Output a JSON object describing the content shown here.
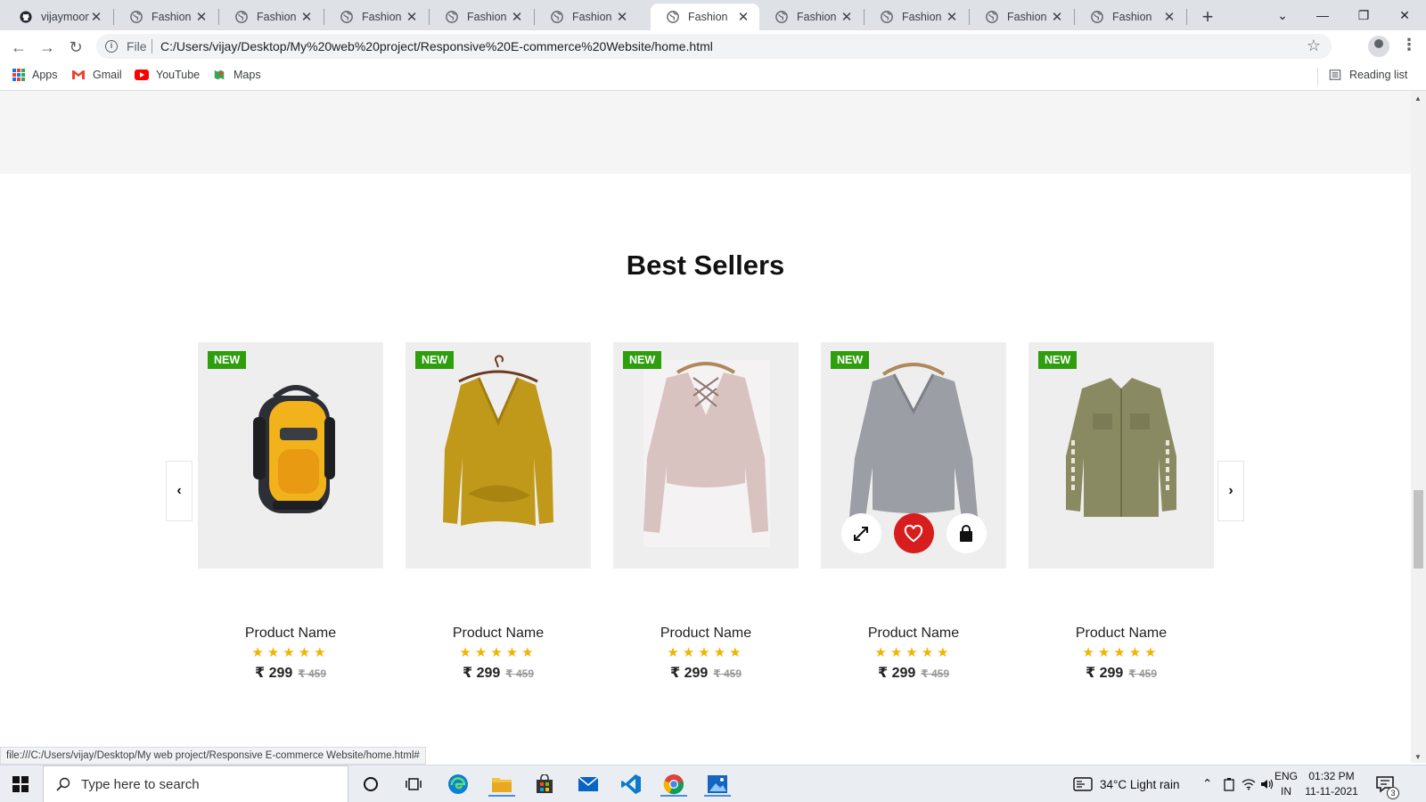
{
  "browser": {
    "tabs": [
      {
        "label": "vijaymoorthi"
      },
      {
        "label": "Fashion"
      },
      {
        "label": "Fashion"
      },
      {
        "label": "Fashion"
      },
      {
        "label": "Fashion"
      },
      {
        "label": "Fashion"
      },
      {
        "label": "Fashion"
      },
      {
        "label": "Fashion"
      },
      {
        "label": "Fashion"
      },
      {
        "label": "Fashion"
      },
      {
        "label": "Fashion"
      }
    ],
    "active_tab_index": 6,
    "address": {
      "scheme_label": "File",
      "url": "C:/Users/vijay/Desktop/My%20web%20project/Responsive%20E-commerce%20Website/home.html"
    },
    "bookmarks": [
      {
        "label": "Apps"
      },
      {
        "label": "Gmail"
      },
      {
        "label": "YouTube"
      },
      {
        "label": "Maps"
      }
    ],
    "reading_list": "Reading list",
    "status_url": "file:///C:/Users/vijay/Desktop/My web project/Responsive E-commerce Website/home.html#"
  },
  "page": {
    "section_title": "Best Sellers",
    "badge_label": "NEW",
    "stars": "★★★★★",
    "products": [
      {
        "name": "Product Name",
        "price": "₹ 299",
        "old_price": "₹ 459",
        "image": "backpack"
      },
      {
        "name": "Product Name",
        "price": "₹ 299",
        "old_price": "₹ 459",
        "image": "mustard-sweater"
      },
      {
        "name": "Product Name",
        "price": "₹ 299",
        "old_price": "₹ 459",
        "image": "pink-sweater"
      },
      {
        "name": "Product Name",
        "price": "₹ 299",
        "old_price": "₹ 459",
        "image": "grey-sweater"
      },
      {
        "name": "Product Name",
        "price": "₹ 299",
        "old_price": "₹ 459",
        "image": "olive-shirt"
      }
    ],
    "hover_actions": [
      "expand-icon",
      "heart-icon",
      "bag-icon"
    ]
  },
  "taskbar": {
    "search_placeholder": "Type here to search",
    "weather": "34°C  Light rain",
    "lang_line1": "ENG",
    "lang_line2": "IN",
    "time": "01:32 PM",
    "date": "11-11-2021",
    "notification_count": "3"
  },
  "colors": {
    "badge": "#2e9e0f",
    "favorite": "#d61e1e",
    "stars": "#f0b400"
  }
}
